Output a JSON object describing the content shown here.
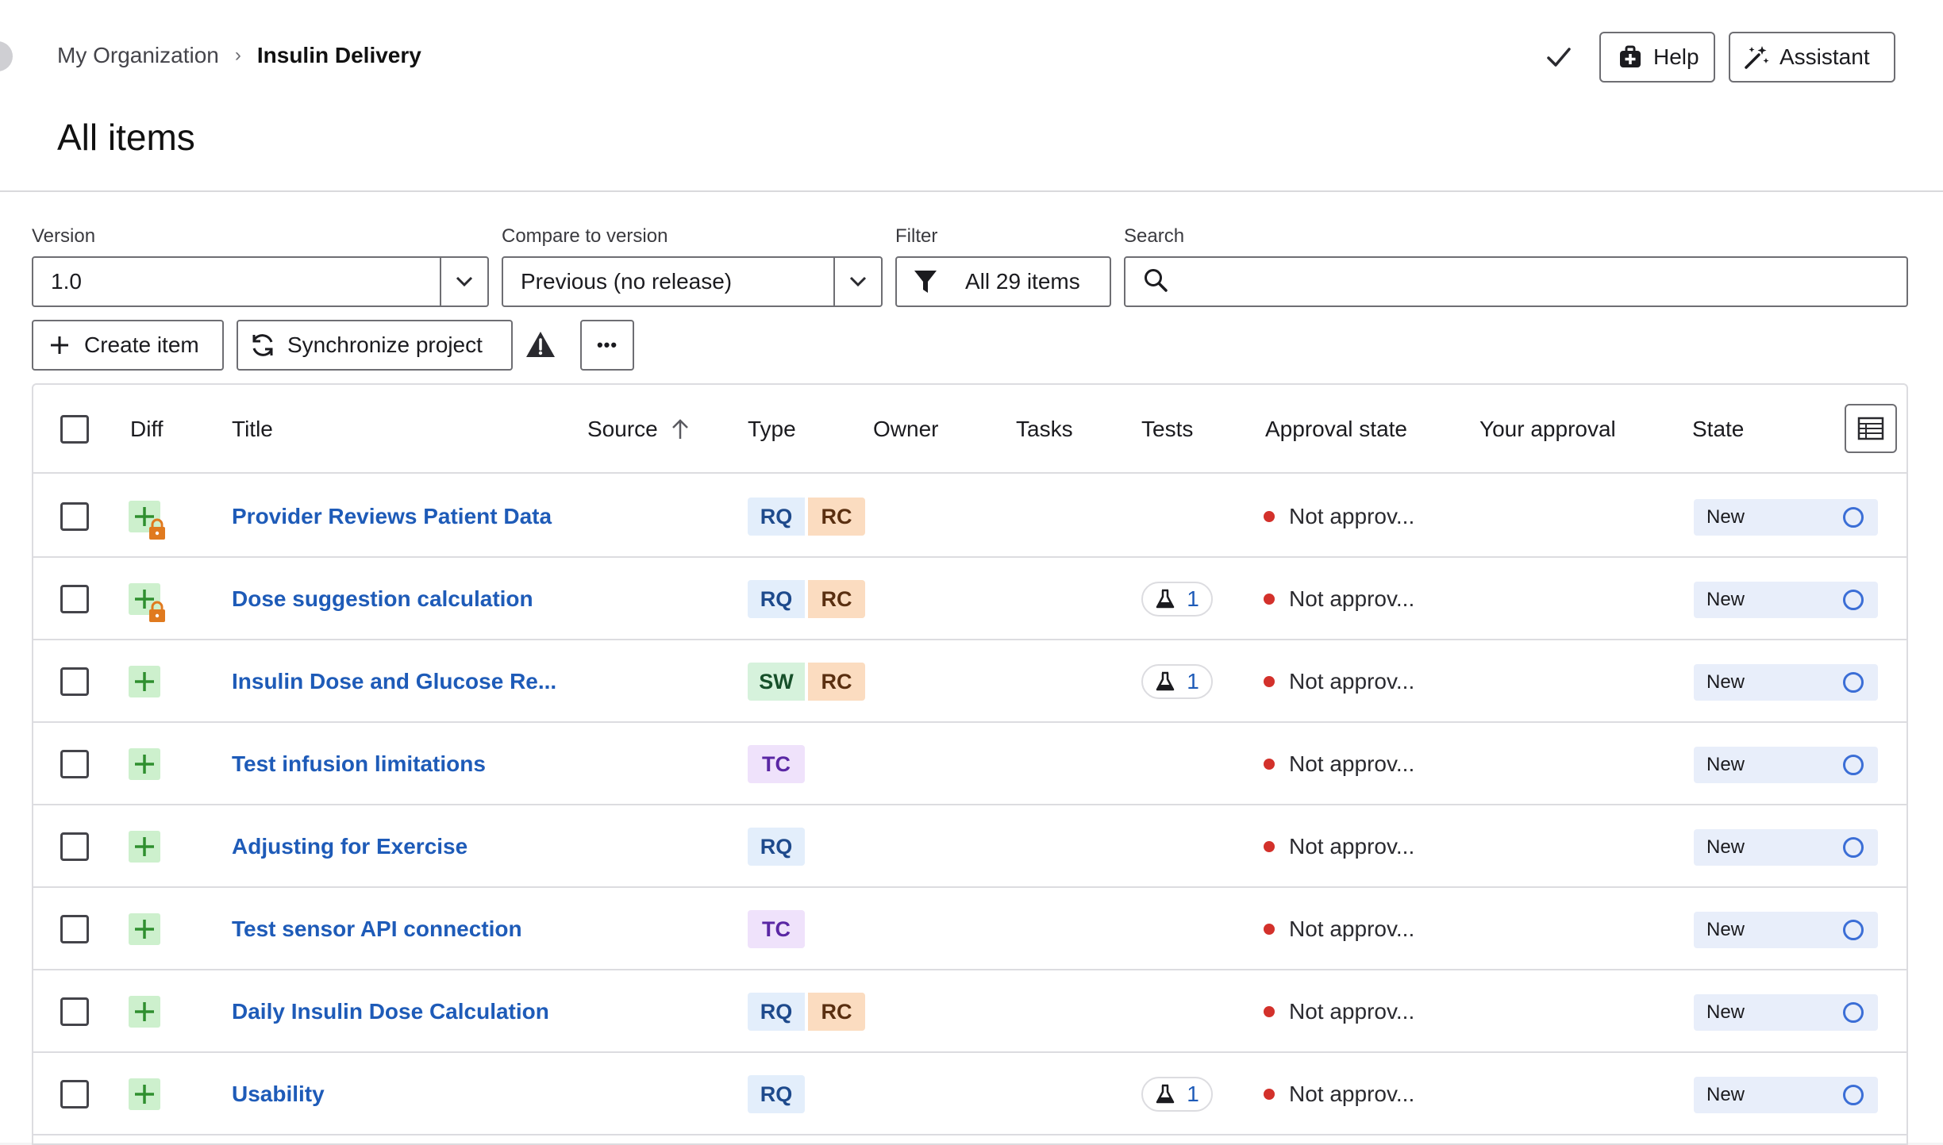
{
  "header": {
    "breadcrumb": {
      "org": "My Organization",
      "separator": "›",
      "current": "Insulin Delivery"
    },
    "page_title": "All items",
    "help_label": "Help",
    "assistant_label": "Assistant"
  },
  "controls": {
    "version_label": "Version",
    "version_value": "1.0",
    "compare_label": "Compare to version",
    "compare_value": "Previous (no release)",
    "filter_label": "Filter",
    "filter_value": "All 29 items",
    "search_label": "Search",
    "search_value": "",
    "create_label": "Create item",
    "sync_label": "Synchronize project",
    "more_label": "•••"
  },
  "table": {
    "columns": {
      "diff": "Diff",
      "title": "Title",
      "source": "Source",
      "type": "Type",
      "owner": "Owner",
      "tasks": "Tasks",
      "tests": "Tests",
      "approval_state": "Approval state",
      "your_approval": "Your approval",
      "state": "State"
    },
    "sort": {
      "column": "Source",
      "direction": "ascending"
    },
    "rows": [
      {
        "title": "Provider Reviews Patient Data",
        "locked": true,
        "types": [
          "RQ",
          "RC"
        ],
        "tests": "",
        "approval": "Not approv...",
        "state": "New"
      },
      {
        "title": "Dose suggestion calculation",
        "locked": true,
        "types": [
          "RQ",
          "RC"
        ],
        "tests": "1",
        "approval": "Not approv...",
        "state": "New"
      },
      {
        "title": "Insulin Dose and Glucose Re...",
        "locked": false,
        "types": [
          "SW",
          "RC"
        ],
        "tests": "1",
        "approval": "Not approv...",
        "state": "New"
      },
      {
        "title": "Test infusion limitations",
        "locked": false,
        "types": [
          "TC"
        ],
        "tests": "",
        "approval": "Not approv...",
        "state": "New"
      },
      {
        "title": "Adjusting for Exercise",
        "locked": false,
        "types": [
          "RQ"
        ],
        "tests": "",
        "approval": "Not approv...",
        "state": "New"
      },
      {
        "title": "Test sensor API connection",
        "locked": false,
        "types": [
          "TC"
        ],
        "tests": "",
        "approval": "Not approv...",
        "state": "New"
      },
      {
        "title": "Daily Insulin Dose Calculation",
        "locked": false,
        "types": [
          "RQ",
          "RC"
        ],
        "tests": "",
        "approval": "Not approv...",
        "state": "New"
      },
      {
        "title": "Usability",
        "locked": false,
        "types": [
          "RQ"
        ],
        "tests": "1",
        "approval": "Not approv...",
        "state": "New"
      }
    ]
  },
  "colors": {
    "link": "#1e5bb8",
    "not_approved_dot": "#d3312b",
    "diff_added_bg": "#cdf0cd",
    "diff_added_fg": "#2f8f2f",
    "lock": "#e07a1f",
    "state_bg": "#e8eefa"
  },
  "icons": {
    "check": "check-icon",
    "help": "help-icon",
    "assistant": "magic-wand-icon",
    "caret": "chevron-down-icon",
    "filter": "funnel-icon",
    "search": "search-icon",
    "create": "plus-icon",
    "sync": "sync-icon",
    "warning": "warning-icon",
    "column_settings": "table-settings-icon",
    "sort": "arrow-up-icon",
    "diff_added": "plus-icon",
    "lock": "lock-icon",
    "tests": "flask-icon",
    "state": "circle-icon"
  }
}
